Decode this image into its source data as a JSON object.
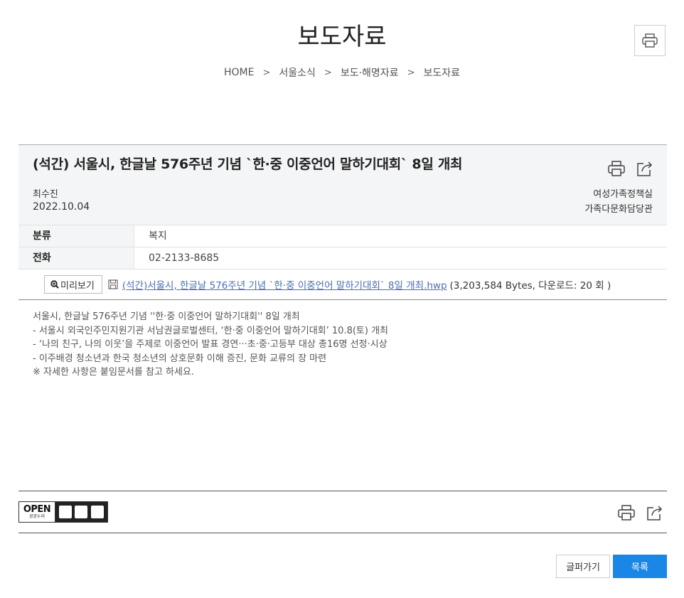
{
  "page": {
    "title": "보도자료"
  },
  "breadcrumb": [
    "HOME",
    "서울소식",
    "보도·해명자료",
    "보도자료"
  ],
  "article": {
    "title": "(석간) 서울시, 한글날 576주년 기념 `한·중 이중언어 말하기대회` 8일 개최",
    "author": "최수진",
    "date": "2022.10.04",
    "dept": "여성가족정책실",
    "subdept": "가족다문화담당관",
    "fields": [
      {
        "label": "분류",
        "value": "복지"
      },
      {
        "label": "전화",
        "value": "02-2133-8685"
      }
    ],
    "attachment": {
      "preview_label": "미리보기",
      "file_name": "(석간)서울시, 한글날 576주년 기념 `한·중 이중언어 말하기대회` 8일 개최.hwp",
      "file_meta": "(3,203,584 Bytes, 다운로드: 20 회 )"
    },
    "body": [
      "서울시, 한글날 576주년 기념 ''한·중 이중언어 말하기대회'' 8일 개최",
      " - 서울시 외국인주민지원기관 서남권글로벌센터, ‘한·중 이중언어 말하기대회’ 10.8(토) 개최",
      " - ‘나의 친구, 나의 이웃’을 주제로 이중언어 발표 경연···초·중·고등부 대상 총16명 선정·시상",
      " - 이주배경 청소년과 한국 청소년의 상호문화 이해 증진, 문화 교류의 장 마련",
      "※ 자세한 사항은 붙임문서를 참고 하세요."
    ]
  },
  "license": {
    "badge_text": "OPEN",
    "sub_text": "공공누리"
  },
  "buttons": {
    "back": "글퍼가기",
    "list": "목록"
  },
  "colors": {
    "primary": "#1a86e6",
    "link": "#4a6fb5"
  }
}
